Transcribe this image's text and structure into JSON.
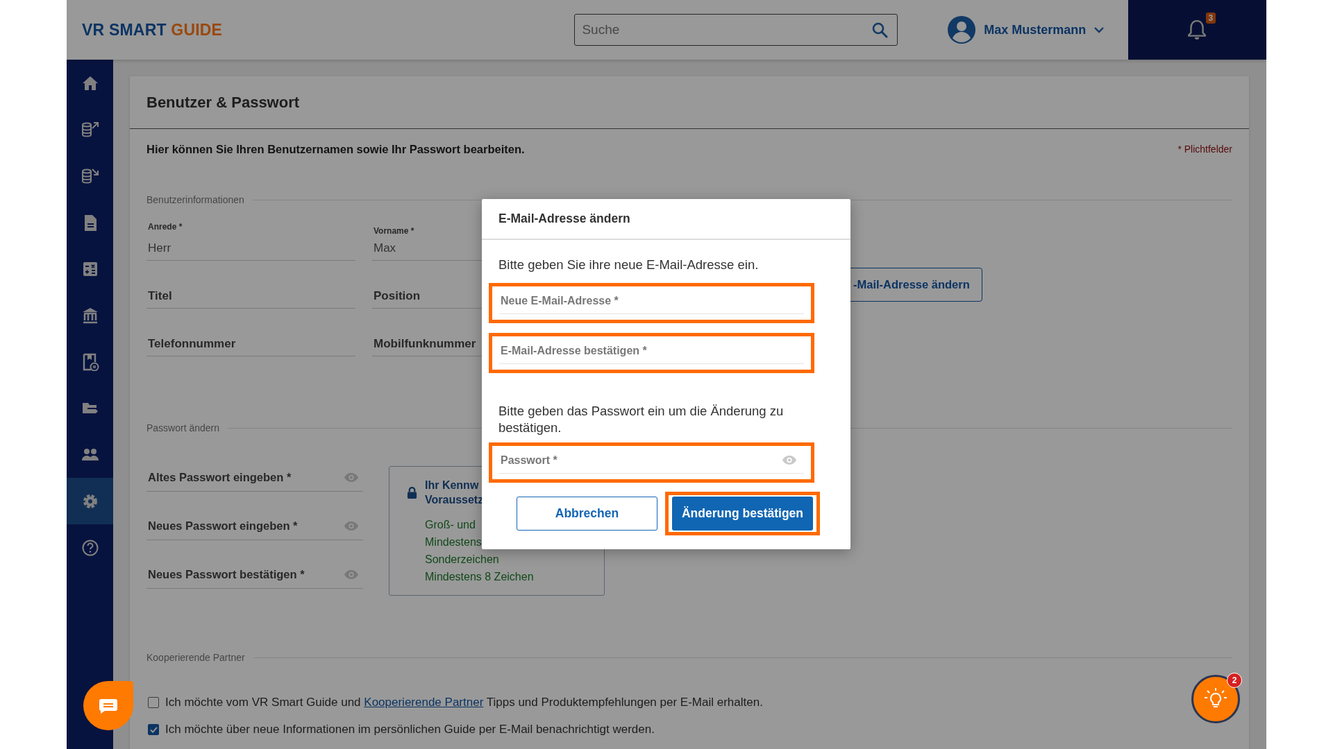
{
  "header": {
    "logo": {
      "primary": "VR SMART",
      "accent": "GUIDE"
    },
    "search": {
      "placeholder": "Suche"
    },
    "user": {
      "name": "Max Mustermann"
    },
    "notifications": {
      "count": "3"
    }
  },
  "sidebar": {
    "items": [
      {
        "kind": "home",
        "selected": false
      },
      {
        "kind": "coins-up",
        "selected": false
      },
      {
        "kind": "coins-down",
        "selected": false
      },
      {
        "kind": "document",
        "selected": false
      },
      {
        "kind": "calculator",
        "selected": false
      },
      {
        "kind": "bank",
        "selected": false
      },
      {
        "kind": "document-euro",
        "selected": false
      },
      {
        "kind": "folder",
        "selected": false
      },
      {
        "kind": "people",
        "selected": false
      },
      {
        "kind": "settings",
        "selected": true
      },
      {
        "kind": "help",
        "selected": false
      }
    ]
  },
  "page": {
    "title": "Benutzer & Passwort",
    "intro": "Hier können Sie Ihren Benutzernamen sowie Ihr Passwort bearbeiten.",
    "required_note": "* Plichtfelder",
    "user_info": {
      "heading": "Benutzerinformationen",
      "fields": [
        {
          "label": "Anrede *",
          "value": "Herr"
        },
        {
          "label": "Vorname *",
          "value": "Max"
        },
        {
          "placeholder": "Titel"
        },
        {
          "placeholder": "Position"
        },
        {
          "placeholder": "Telefonnummer"
        },
        {
          "placeholder": "Mobilfunknummer"
        }
      ],
      "email_button": "-Mail-Adresse ändern"
    },
    "password": {
      "heading": "Passwort ändern",
      "fields": [
        {
          "placeholder": "Altes Passwort eingeben *"
        },
        {
          "placeholder": "Neues Passwort eingeben *"
        },
        {
          "placeholder": "Neues Passwort bestätigen *"
        }
      ],
      "requirements": {
        "title_lines": [
          "Ihr Kennw",
          "Voraussetz"
        ],
        "items": [
          "Groß- und",
          "Mindestens",
          "Sonderzeichen",
          "Mindestens 8 Zeichen"
        ]
      }
    },
    "partners": {
      "heading": "Kooperierende Partner",
      "options": [
        {
          "checked": false,
          "text_before": "Ich möchte vom VR Smart Guide und",
          "link": "Kooperierende Partner",
          "text_after": "Tipps und Produktempfehlungen per E-Mail erhalten."
        },
        {
          "checked": true,
          "text_before": "Ich möchte über neue Informationen im persönlichen Guide per E-Mail benachrichtigt werden."
        }
      ]
    }
  },
  "dialog": {
    "title": "E-Mail-Adresse ändern",
    "intro": "Bitte geben Sie ihre neue E-Mail-Adresse ein.",
    "fields": [
      {
        "placeholder": "Neue E-Mail-Adresse *",
        "highlighted": true
      },
      {
        "placeholder": "E-Mail-Adresse bestätigen *",
        "highlighted": true
      }
    ],
    "password_intro": "Bitte geben das Passwort ein um die Änderung zu bestätigen.",
    "password_field": {
      "placeholder": "Passwort *",
      "highlighted": true
    },
    "buttons": [
      {
        "label": "Abbrechen",
        "kind": "secondary",
        "highlighted": false
      },
      {
        "label": "Änderung bestätigen",
        "kind": "primary",
        "highlighted": true
      }
    ]
  },
  "help_button": {
    "count": "2"
  }
}
